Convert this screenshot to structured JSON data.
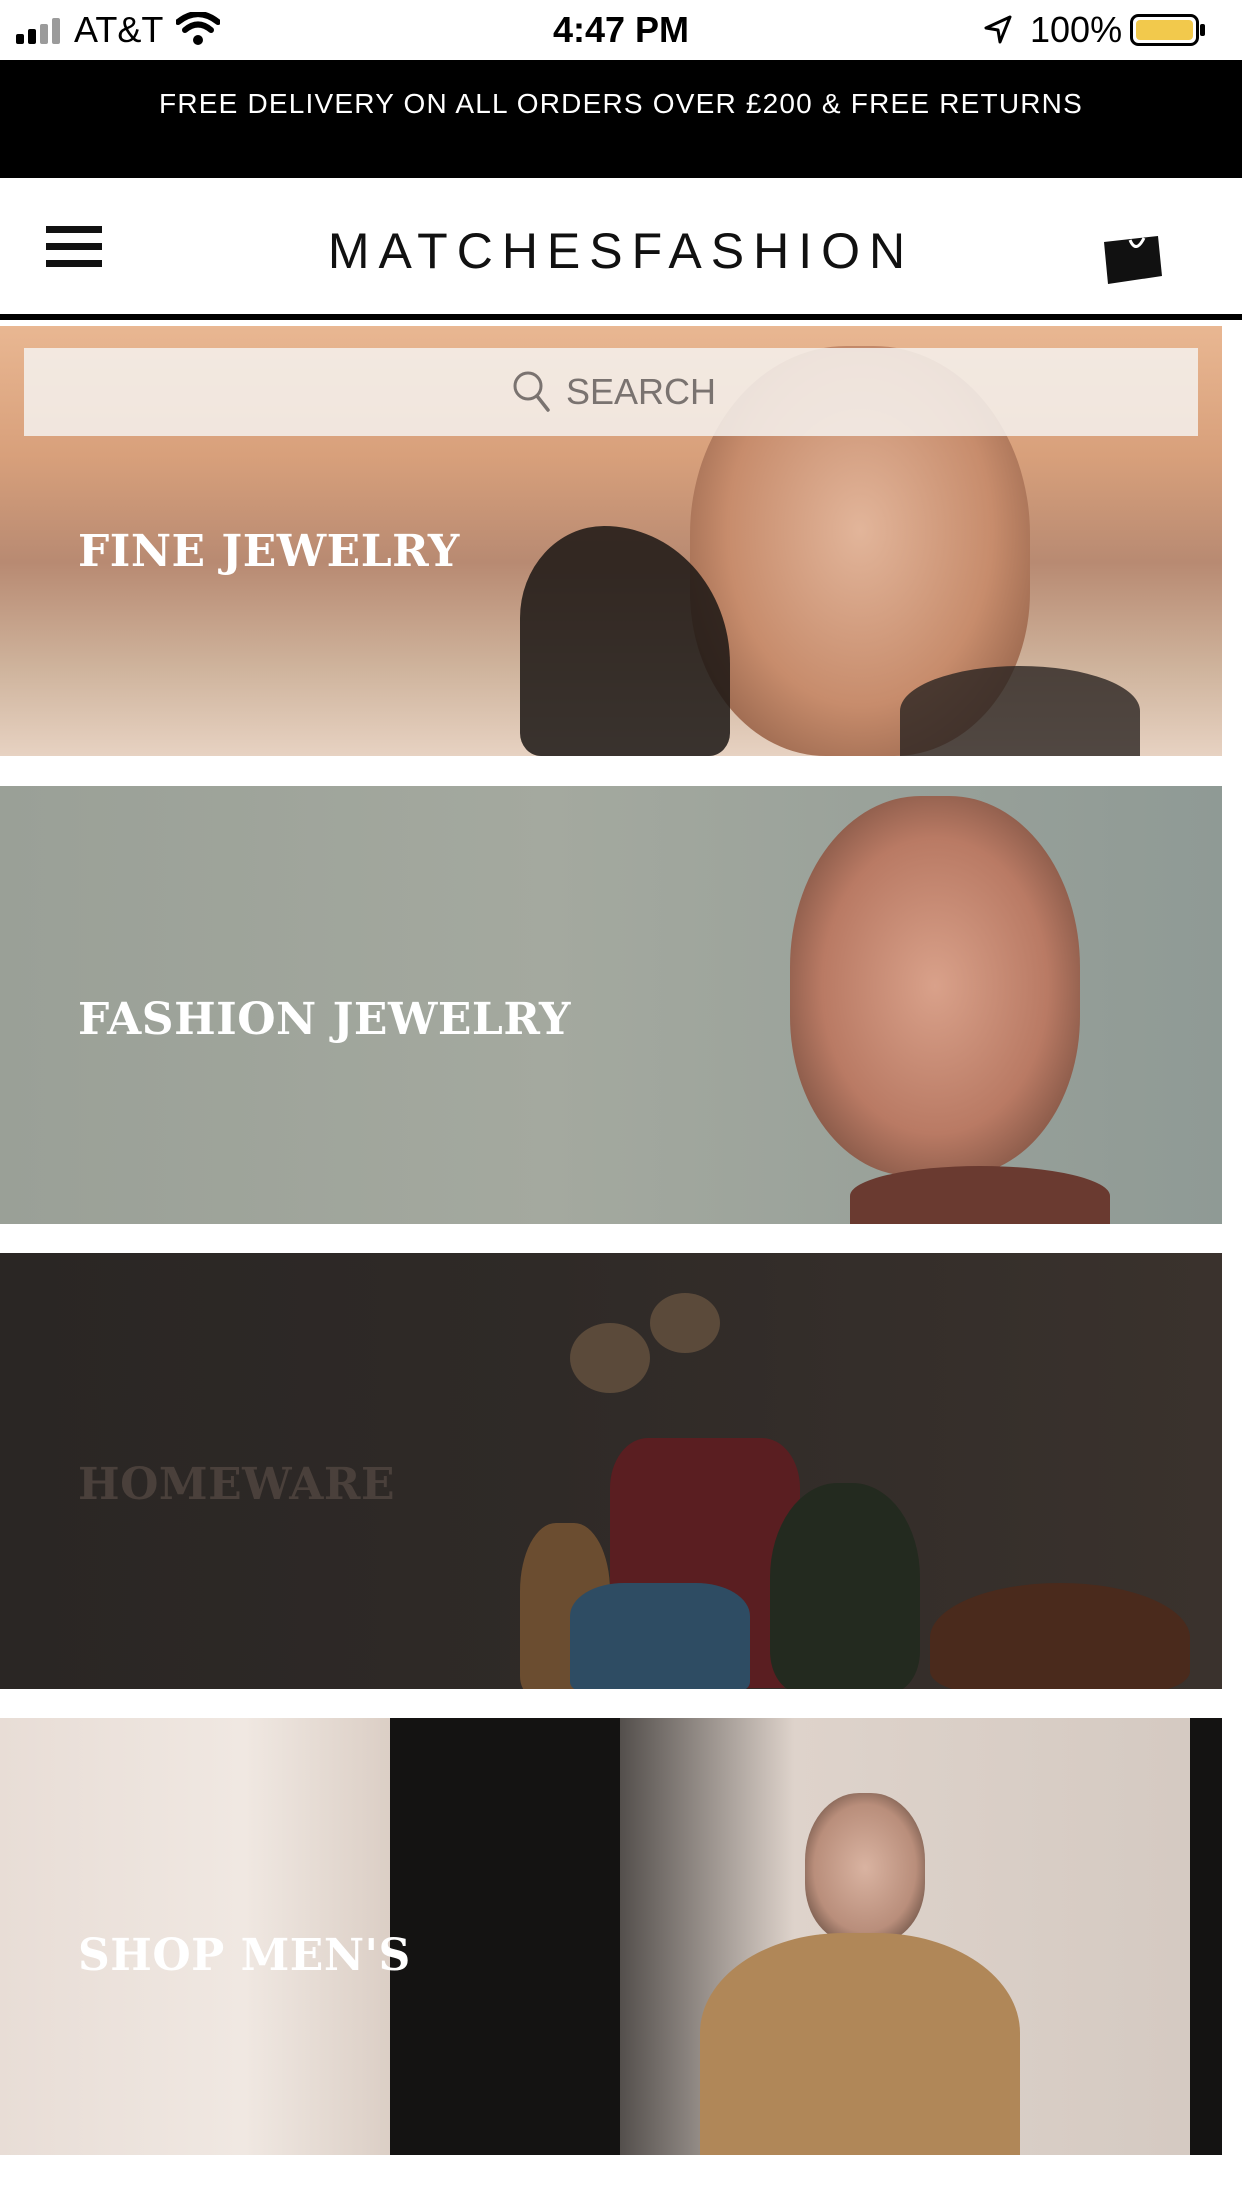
{
  "status_bar": {
    "carrier": "AT&T",
    "time": "4:47 PM",
    "battery_percent": "100%",
    "battery_color": "#f2c94c"
  },
  "promo_banner": {
    "text": "FREE DELIVERY ON ALL ORDERS OVER £200 & FREE RETURNS"
  },
  "header": {
    "logo_text": "MATCHESFASHION",
    "menu_icon": "hamburger-menu-icon",
    "bag_icon": "shopping-bag-icon"
  },
  "search": {
    "label": "SEARCH",
    "icon": "search-icon"
  },
  "tiles": [
    {
      "label": "FINE JEWELRY"
    },
    {
      "label": "FASHION JEWELRY"
    },
    {
      "label": "HOMEWARE"
    },
    {
      "label": "SHOP MEN'S"
    }
  ]
}
